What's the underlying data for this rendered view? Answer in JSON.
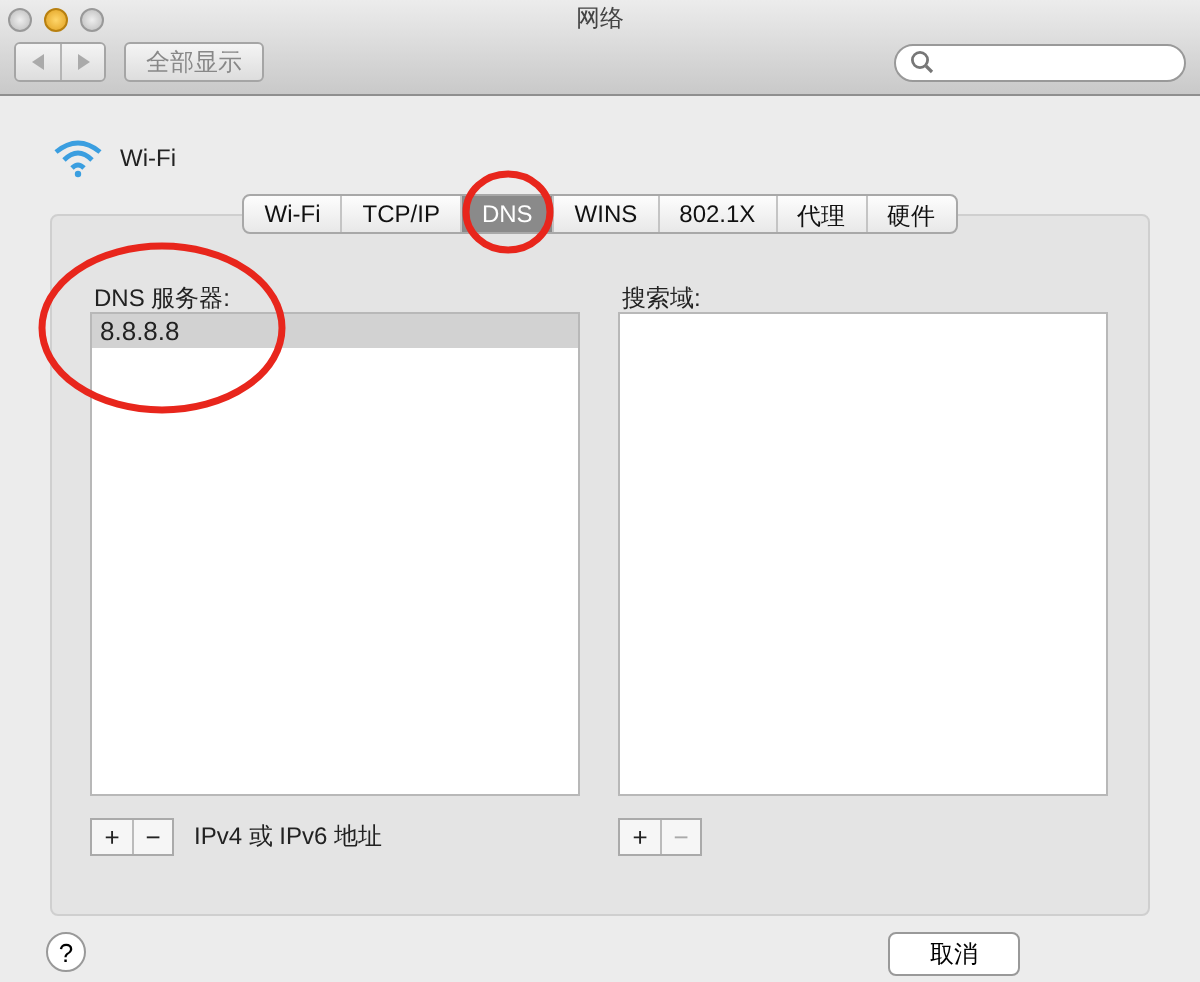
{
  "window": {
    "title": "网络"
  },
  "toolbar": {
    "show_all": "全部显示"
  },
  "service": {
    "name": "Wi-Fi"
  },
  "tabs": [
    {
      "label": "Wi-Fi",
      "selected": false
    },
    {
      "label": "TCP/IP",
      "selected": false
    },
    {
      "label": "DNS",
      "selected": true
    },
    {
      "label": "WINS",
      "selected": false
    },
    {
      "label": "802.1X",
      "selected": false
    },
    {
      "label": "代理",
      "selected": false
    },
    {
      "label": "硬件",
      "selected": false
    }
  ],
  "dns_servers": {
    "label": "DNS 服务器:",
    "items": [
      {
        "text": "8.8.8.8",
        "selected": true
      }
    ],
    "hint": "IPv4 或 IPv6 地址",
    "remove_disabled": false
  },
  "search_domains": {
    "label": "搜索域:",
    "remove_disabled": true
  },
  "buttons": {
    "add": "+",
    "remove": "−",
    "help": "?",
    "cancel": "取消"
  },
  "annotations": [
    {
      "kind": "circle"
    },
    {
      "kind": "circle"
    }
  ]
}
